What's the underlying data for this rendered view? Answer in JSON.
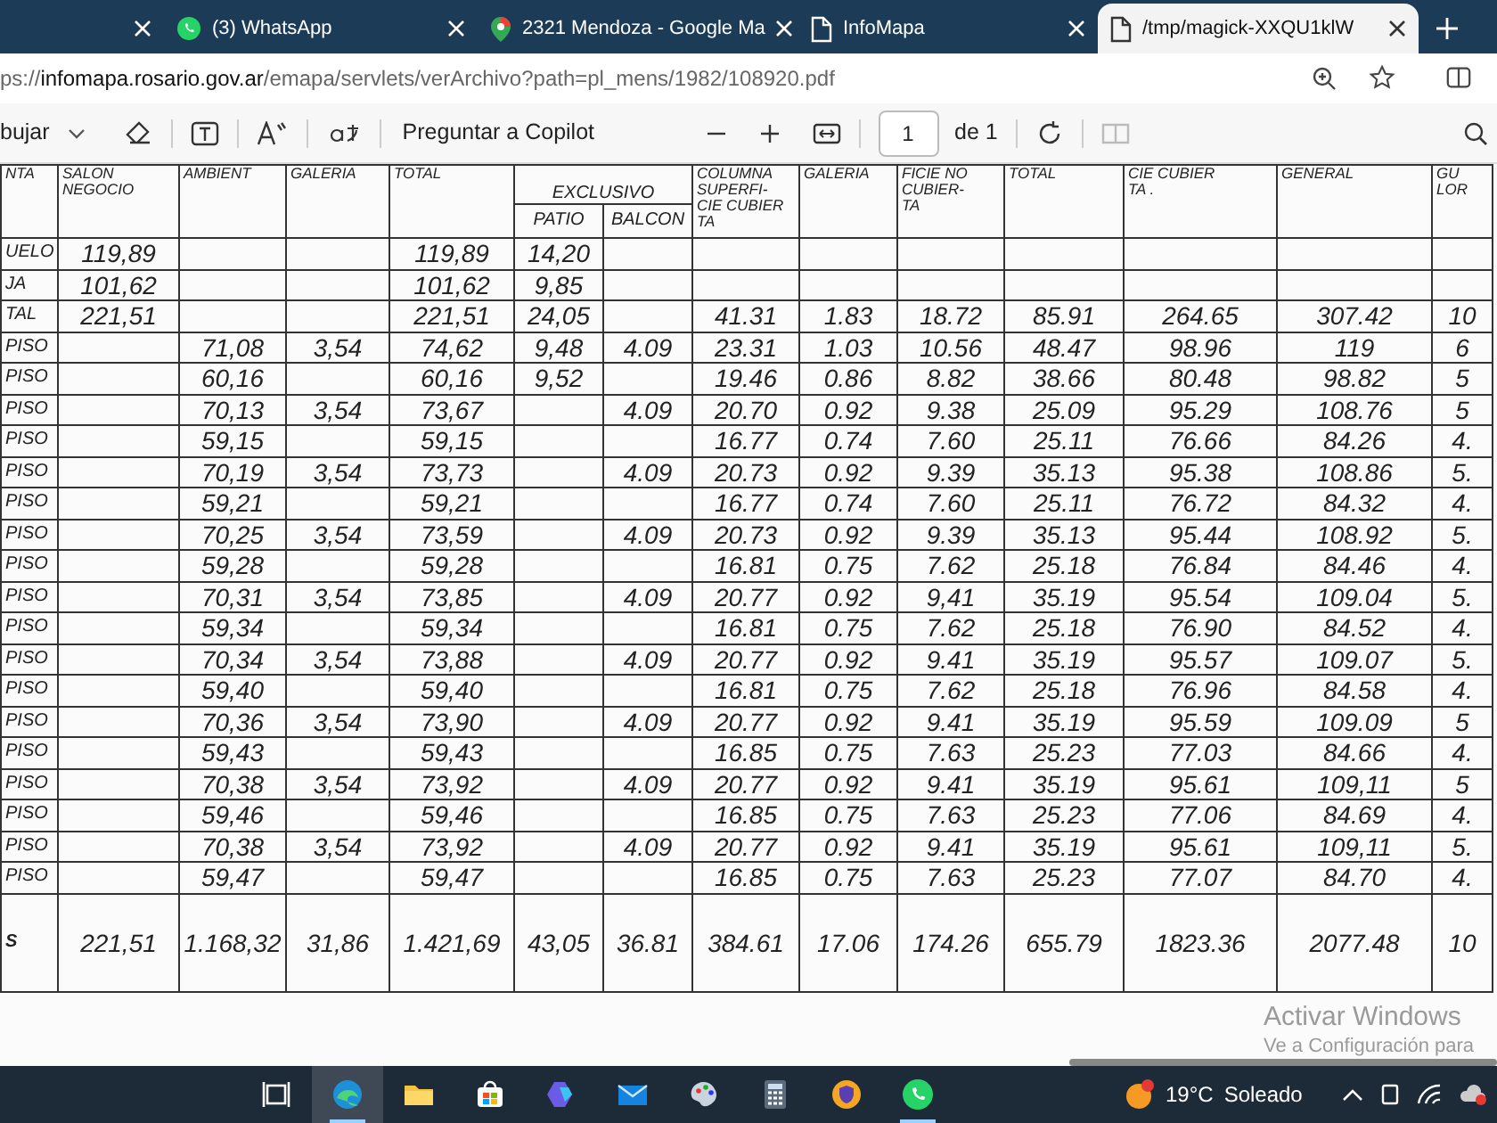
{
  "tabs": [
    {
      "kind": "blank",
      "selected": false
    },
    {
      "kind": "whatsapp",
      "title": "(3) WhatsApp",
      "selected": false
    },
    {
      "kind": "maps",
      "title": "2321 Mendoza - Google Ma",
      "selected": false
    },
    {
      "kind": "document",
      "title": "InfoMapa",
      "selected": false
    },
    {
      "kind": "document",
      "title": "/tmp/magick-XXQU1klW",
      "selected": true
    }
  ],
  "address": {
    "prefix": "ps://",
    "domain": "infomapa.rosario.gov.ar",
    "path": "/emapa/servlets/verArchivo?path=pl_mens/1982/108920.pdf"
  },
  "pdf_toolbar": {
    "draw_label": "bujar",
    "ask_copilot": "Preguntar a Copilot",
    "page": "1",
    "page_total": "de 1"
  },
  "document": {
    "group_header": "EXCLUSIVO",
    "columns": [
      "NTA",
      "SALON\nNEGOCIO",
      "AMBIENT",
      "GALERIA",
      "TOTAL",
      "PATIO",
      "BALCON",
      "COLUMNA\nSUPERFI-\nCIE CUBIER\nTA",
      "GALERIA",
      "FICIE NO\nCUBIER-\nTA",
      "TOTAL",
      "CIE CUBIER\nTA .",
      "GENERAL",
      "GU\nLOR"
    ],
    "rows": [
      [
        "UELO",
        "119,89",
        null,
        null,
        "119,89",
        "14,20",
        null,
        null,
        null,
        null,
        null,
        null,
        null,
        null
      ],
      [
        "JA",
        "101,62",
        null,
        null,
        "101,62",
        "9,85",
        null,
        null,
        null,
        null,
        null,
        null,
        null,
        null
      ],
      [
        "TAL",
        "221,51",
        null,
        null,
        "221,51",
        "24,05",
        null,
        "41.31",
        "1.83",
        "18.72",
        "85.91",
        "264.65",
        "307.42",
        "10"
      ],
      [
        "PISO",
        null,
        "71,08",
        "3,54",
        "74,62",
        "9,48",
        "4.09",
        "23.31",
        "1.03",
        "10.56",
        "48.47",
        "98.96",
        "119",
        "6"
      ],
      [
        "PISO",
        null,
        "60,16",
        null,
        "60,16",
        "9,52",
        null,
        "19.46",
        "0.86",
        "8.82",
        "38.66",
        "80.48",
        "98.82",
        "5"
      ],
      [
        "PISO",
        null,
        "70,13",
        "3,54",
        "73,67",
        null,
        "4.09",
        "20.70",
        "0.92",
        "9.38",
        "25.09",
        "95.29",
        "108.76",
        "5"
      ],
      [
        "PISO",
        null,
        "59,15",
        null,
        "59,15",
        null,
        null,
        "16.77",
        "0.74",
        "7.60",
        "25.11",
        "76.66",
        "84.26",
        "4."
      ],
      [
        "PISO",
        null,
        "70,19",
        "3,54",
        "73,73",
        null,
        "4.09",
        "20.73",
        "0.92",
        "9.39",
        "35.13",
        "95.38",
        "108.86",
        "5."
      ],
      [
        "PISO",
        null,
        "59,21",
        null,
        "59,21",
        null,
        null,
        "16.77",
        "0.74",
        "7.60",
        "25.11",
        "76.72",
        "84.32",
        "4."
      ],
      [
        "PISO",
        null,
        "70,25",
        "3,54",
        "73,59",
        null,
        "4.09",
        "20.73",
        "0.92",
        "9.39",
        "35.13",
        "95.44",
        "108.92",
        "5."
      ],
      [
        "PISO",
        null,
        "59,28",
        null,
        "59,28",
        null,
        null,
        "16.81",
        "0.75",
        "7.62",
        "25.18",
        "76.84",
        "84.46",
        "4."
      ],
      [
        "PISO",
        null,
        "70,31",
        "3,54",
        "73,85",
        null,
        "4.09",
        "20.77",
        "0.92",
        "9,41",
        "35.19",
        "95.54",
        "109.04",
        "5."
      ],
      [
        "PISO",
        null,
        "59,34",
        null,
        "59,34",
        null,
        null,
        "16.81",
        "0.75",
        "7.62",
        "25.18",
        "76.90",
        "84.52",
        "4."
      ],
      [
        "PISO",
        null,
        "70,34",
        "3,54",
        "73,88",
        null,
        "4.09",
        "20.77",
        "0.92",
        "9.41",
        "35.19",
        "95.57",
        "109.07",
        "5."
      ],
      [
        "PISO",
        null,
        "59,40",
        null,
        "59,40",
        null,
        null,
        "16.81",
        "0.75",
        "7.62",
        "25.18",
        "76.96",
        "84.58",
        "4."
      ],
      [
        "PISO",
        null,
        "70,36",
        "3,54",
        "73,90",
        null,
        "4.09",
        "20.77",
        "0.92",
        "9.41",
        "35.19",
        "95.59",
        "109.09",
        "5"
      ],
      [
        "PISO",
        null,
        "59,43",
        null,
        "59,43",
        null,
        null,
        "16.85",
        "0.75",
        "7.63",
        "25.23",
        "77.03",
        "84.66",
        "4."
      ],
      [
        "PISO",
        null,
        "70,38",
        "3,54",
        "73,92",
        null,
        "4.09",
        "20.77",
        "0.92",
        "9.41",
        "35.19",
        "95.61",
        "109,11",
        "5"
      ],
      [
        "PISO",
        null,
        "59,46",
        null,
        "59,46",
        null,
        null,
        "16.85",
        "0.75",
        "7.63",
        "25.23",
        "77.06",
        "84.69",
        "4."
      ],
      [
        "PISO",
        null,
        "70,38",
        "3,54",
        "73,92",
        null,
        "4.09",
        "20.77",
        "0.92",
        "9.41",
        "35.19",
        "95.61",
        "109,11",
        "5."
      ],
      [
        "PISO",
        null,
        "59,47",
        null,
        "59,47",
        null,
        null,
        "16.85",
        "0.75",
        "7.63",
        "25.23",
        "77.07",
        "84.70",
        "4."
      ]
    ],
    "totals": [
      "S",
      "221,51",
      "1.168,32",
      "31,86",
      "1.421,69",
      "43,05",
      "36.81",
      "384.61",
      "17.06",
      "174.26",
      "655.79",
      "1823.36",
      "2077.48",
      "10"
    ]
  },
  "activation_notice": {
    "title": "Activar Windows",
    "subtitle": "Ve a Configuración para"
  },
  "taskbar": {
    "apps": [
      {
        "kind": "taskview",
        "selected": false,
        "running": false
      },
      {
        "kind": "edge",
        "selected": true,
        "running": true
      },
      {
        "kind": "files",
        "selected": false,
        "running": false
      },
      {
        "kind": "store",
        "selected": false,
        "running": false
      },
      {
        "kind": "copilot",
        "selected": false,
        "running": false
      },
      {
        "kind": "mail",
        "selected": false,
        "running": false
      },
      {
        "kind": "paint",
        "selected": false,
        "running": false
      },
      {
        "kind": "calculator",
        "selected": false,
        "running": false
      },
      {
        "kind": "vpn",
        "selected": false,
        "running": false
      },
      {
        "kind": "whatsapp",
        "selected": false,
        "running": true
      }
    ],
    "weather": {
      "temperature": "19°C",
      "condition": "Soleado"
    }
  }
}
